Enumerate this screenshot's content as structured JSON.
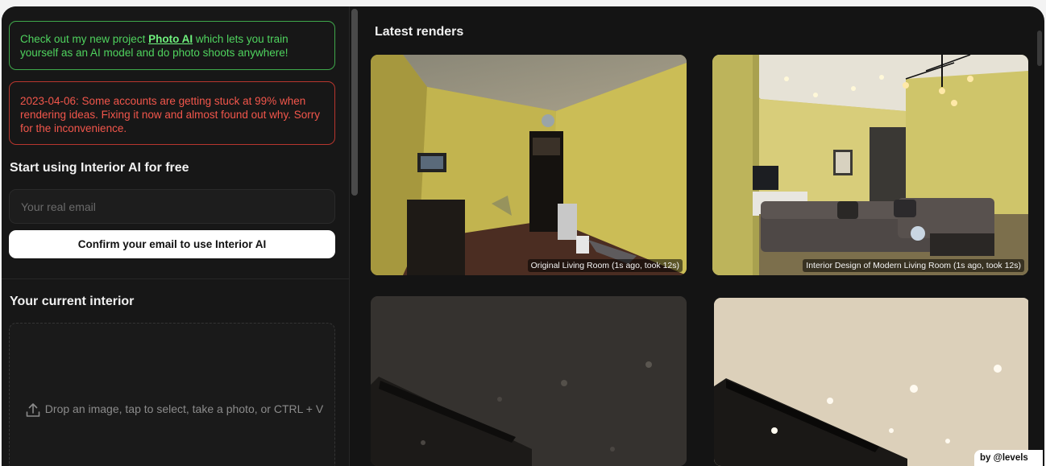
{
  "sidebar": {
    "notice_green": {
      "prefix": "Check out my new project ",
      "link": "Photo AI",
      "suffix": " which lets you train yourself as an AI model and do photo shoots anywhere!"
    },
    "notice_red": "2023-04-06: Some accounts are getting stuck at 99% when rendering ideas. Fixing it now and almost found out why. Sorry for the inconvenience.",
    "signup": {
      "title": "Start using Interior AI for free",
      "email_placeholder": "Your real email",
      "confirm_label": "Confirm your email to use Interior AI"
    },
    "current_interior": {
      "title": "Your current interior",
      "dropzone_text": "Drop an image, tap to select, take a photo, or CTRL + V"
    }
  },
  "main": {
    "title": "Latest renders",
    "renders": [
      {
        "caption": "Original Living Room (1s ago, took 12s)"
      },
      {
        "caption": "Interior Design of Modern Living Room (1s ago, took 12s)"
      },
      {
        "caption": ""
      },
      {
        "caption": ""
      }
    ]
  },
  "badge": "by @levels",
  "icons": [
    "upload-icon"
  ],
  "colors": {
    "background": "#141414",
    "notice_green": "#4fd35e",
    "notice_red": "#f2564b",
    "button_bg": "#ffffff"
  }
}
